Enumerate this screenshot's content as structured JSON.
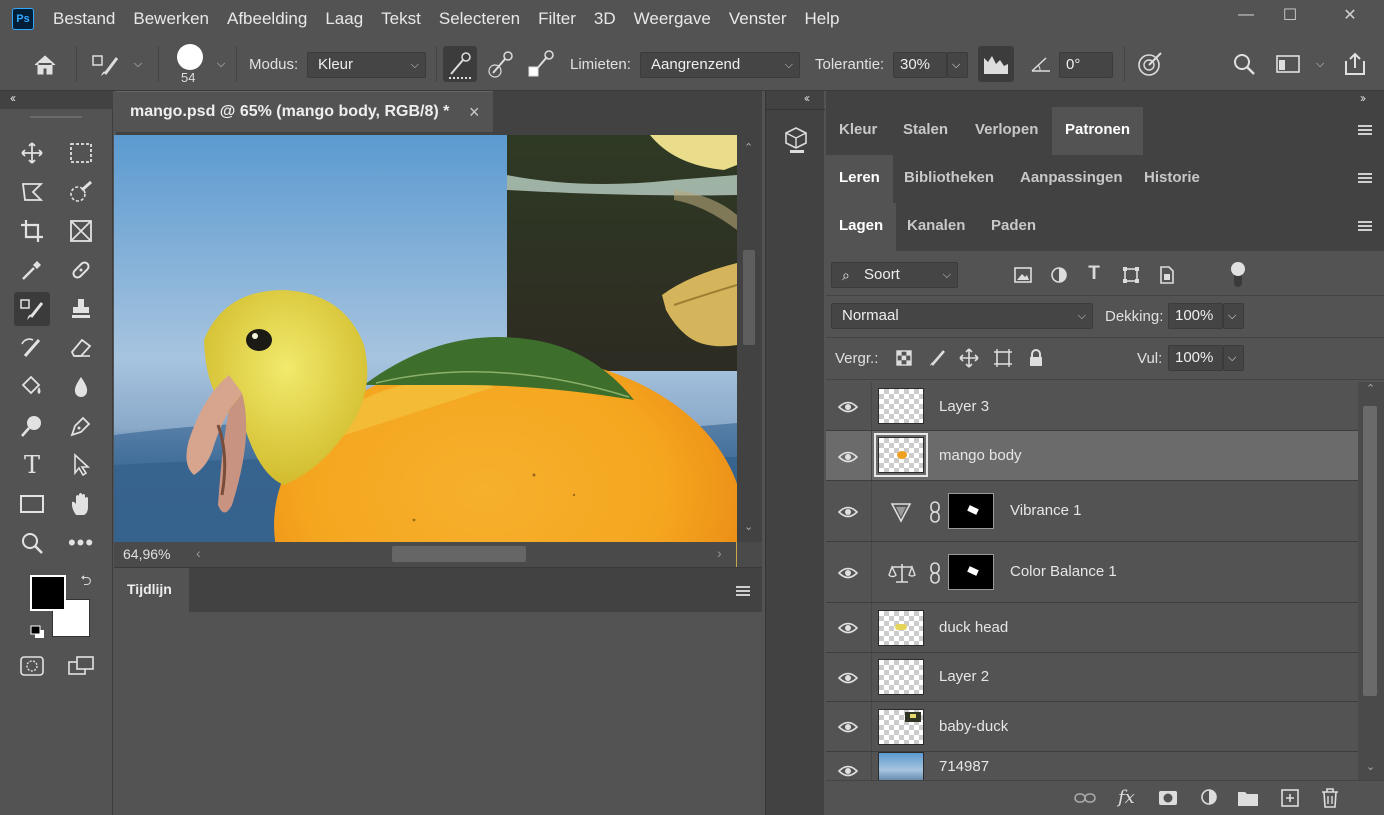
{
  "app": {
    "logo_text": "Ps",
    "menus": [
      "Bestand",
      "Bewerken",
      "Afbeelding",
      "Laag",
      "Tekst",
      "Selecteren",
      "Filter",
      "3D",
      "Weergave",
      "Venster",
      "Help"
    ],
    "window_controls": {
      "minimize": "—",
      "maximize": "☐",
      "close": "✕"
    }
  },
  "options_bar": {
    "brush_size": "54",
    "mode_label": "Modus:",
    "mode_value": "Kleur",
    "limits_label": "Limieten:",
    "limits_value": "Aangrenzend",
    "tolerance_label": "Tolerantie:",
    "tolerance_value": "30%",
    "angle_value": "0°"
  },
  "panel_collapse": {
    "left": "‹‹",
    "mid": "‹‹",
    "right": "››"
  },
  "document": {
    "tab_title": "mango.psd @ 65% (mango body, RGB/8) *",
    "close_glyph": "×",
    "zoom": "64,96%"
  },
  "timeline": {
    "tab_label": "Tijdlijn"
  },
  "panels": {
    "group1_tabs": [
      "Kleur",
      "Stalen",
      "Verlopen",
      "Patronen"
    ],
    "group1_active": "Patronen",
    "group2_tabs": [
      "Leren",
      "Bibliotheken",
      "Aanpassingen",
      "Historie"
    ],
    "group2_active": "Leren",
    "group3_tabs": [
      "Lagen",
      "Kanalen",
      "Paden"
    ],
    "group3_active": "Lagen"
  },
  "layers_panel": {
    "filter_value": "Soort",
    "blend_mode": "Normaal",
    "opacity_label": "Dekking:",
    "opacity_value": "100%",
    "lock_label": "Vergr.:",
    "fill_label": "Vul:",
    "fill_value": "100%",
    "layers": [
      {
        "name": "Layer 3",
        "type": "pixel",
        "selected": false
      },
      {
        "name": "mango body",
        "type": "pixel",
        "selected": true
      },
      {
        "name": "Vibrance 1",
        "type": "adjustment",
        "icon": "vibrance-icon"
      },
      {
        "name": "Color Balance 1",
        "type": "adjustment",
        "icon": "color-balance-icon"
      },
      {
        "name": "duck head",
        "type": "pixel",
        "selected": false
      },
      {
        "name": "Layer 2",
        "type": "pixel",
        "selected": false
      },
      {
        "name": "baby-duck",
        "type": "pixel",
        "selected": false
      },
      {
        "name": "714987",
        "type": "pixel",
        "selected": false
      }
    ],
    "bottom_icons": [
      "link-icon",
      "fx-icon",
      "mask-icon",
      "adjustment-icon",
      "folder-icon",
      "new-layer-icon",
      "trash-icon"
    ],
    "fx_text": "fx"
  },
  "colors": {
    "ui_bg": "#535353",
    "panel_dark": "#424242",
    "selected_layer": "#6b6b6b",
    "accent_blue": "#31a8ff",
    "foreground_color": "#000000",
    "background_color": "#ffffff"
  }
}
